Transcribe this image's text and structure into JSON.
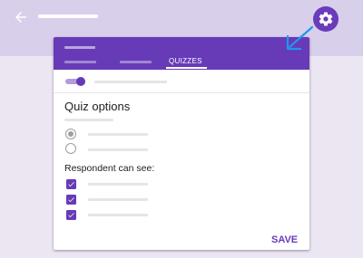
{
  "colors": {
    "accent": "#673ab7",
    "topbar": "#d8cfea",
    "background": "#ece6f3",
    "arrow": "#2196f3"
  },
  "topbar": {
    "back_icon": "arrow-back-icon",
    "settings_icon": "gear-icon"
  },
  "card": {
    "tabs": {
      "active_label": "QUIZZES"
    },
    "make_quiz_toggle": {
      "on": true
    },
    "quiz_options_heading": "Quiz options",
    "release_grade_options": {
      "selected_index": 0
    },
    "respondent_heading": "Respondent can see:",
    "respondent_checkboxes": [
      {
        "checked": true
      },
      {
        "checked": true
      },
      {
        "checked": true
      }
    ],
    "save_label": "SAVE"
  }
}
